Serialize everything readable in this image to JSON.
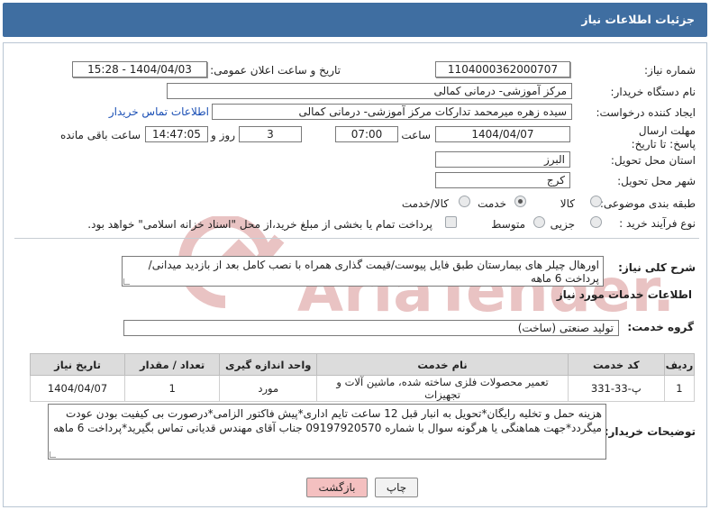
{
  "title": "جزئیات اطلاعات نیاز",
  "fields": {
    "need_number_label": "شماره نیاز:",
    "need_number": "1104000362000707",
    "announce_label": "تاریخ و ساعت اعلان عمومی:",
    "announce_value": "1404/04/03 - 15:28",
    "buyer_org_label": "نام دستگاه خریدار:",
    "buyer_org": "مرکز آموزشی- درمانی کمالی",
    "requester_label": "ایجاد کننده درخواست:",
    "requester": "سیده زهره میرمحمد تدارکات مرکز آموزشی- درمانی کمالی",
    "contact_link": "اطلاعات تماس خریدار",
    "deadline_label": "مهلت ارسال پاسخ: تا تاریخ:",
    "deadline_date": "1404/04/07",
    "time_label": "ساعت",
    "deadline_time": "07:00",
    "days_value": "3",
    "days_label": "روز و",
    "remaining_time": "14:47:05",
    "remaining_label": "ساعت باقی مانده",
    "province_label": "استان محل تحویل:",
    "province": "البرز",
    "city_label": "شهر محل تحویل:",
    "city": "کرج",
    "category_label": "طبقه بندی موضوعی:",
    "category_options": [
      "کالا",
      "خدمت",
      "کالا/خدمت"
    ],
    "category_selected": "خدمت",
    "process_label": "نوع فرآیند خرید :",
    "process_options": [
      "جزیی",
      "متوسط"
    ],
    "process_selected": "",
    "payment_note": "پرداخت تمام یا بخشی از مبلغ خرید،از محل \"اسناد خزانه اسلامی\" خواهد بود."
  },
  "summary": {
    "label": "شرح کلی نیاز:",
    "text": "اورهال چیلر های بیمارستان طبق فایل پیوست/قیمت گذاری همراه با نصب کامل بعد از بازدید میدانی/پرداخت 6 ماهه"
  },
  "services": {
    "section_title": "اطلاعات خدمات مورد نیاز",
    "group_label": "گروه خدمت:",
    "group_value": "تولید صنعتی (ساخت)",
    "columns": [
      "ردیف",
      "کد خدمت",
      "نام خدمت",
      "واحد اندازه گیری",
      "تعداد / مقدار",
      "تاریخ نیاز"
    ],
    "rows": [
      [
        "1",
        "پ-33-331",
        "تعمیر محصولات فلزی ساخته شده، ماشین آلات و تجهیزات",
        "مورد",
        "1",
        "1404/04/07"
      ]
    ]
  },
  "buyer_notes": {
    "label": "توضیحات خریدار:",
    "text": "هزینه حمل و تخلیه رایگان*تحویل به انبار قبل 12 ساعت تایم اداری*پیش فاکتور الزامی*درصورت بی کیفیت بودن عودت میگردد*جهت هماهنگی یا هرگونه سوال با شماره 09197920570 جناب آقای مهندس قدیانی تماس بگیرید*پرداخت 6 ماهه"
  },
  "buttons": {
    "print": "چاپ",
    "back": "بازگشت"
  },
  "watermark": "AriaTender.neT",
  "colors": {
    "titlebar": "#3f6ea1",
    "link": "#1a4fb5",
    "back_button": "#f4c0c0",
    "watermark": "#e9c3c3"
  }
}
